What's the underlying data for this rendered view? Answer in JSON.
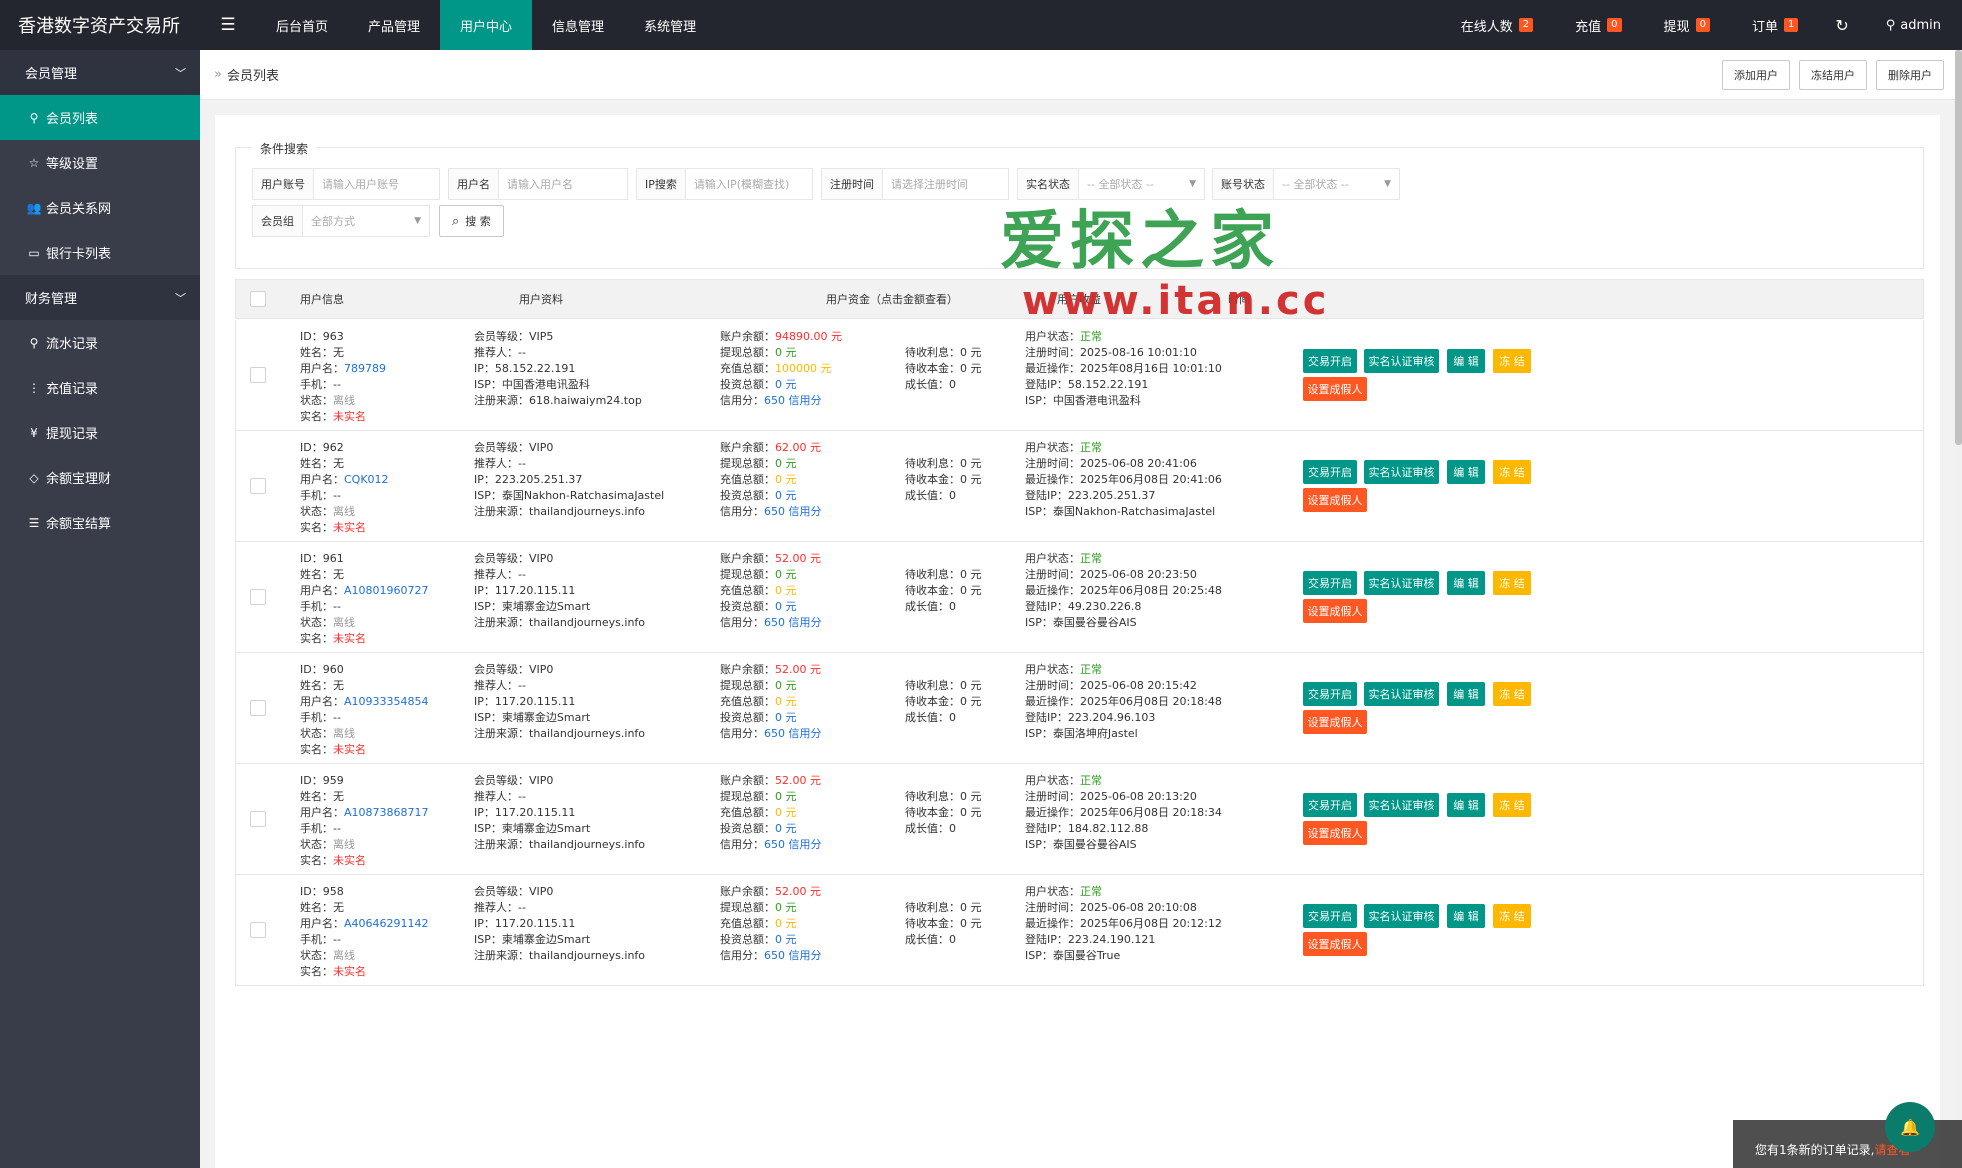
{
  "app": {
    "title": "香港数字资产交易所"
  },
  "header": {
    "menu_icon": "hamburger-icon",
    "nav": [
      {
        "label": "后台首页",
        "active": false
      },
      {
        "label": "产品管理",
        "active": false
      },
      {
        "label": "用户中心",
        "active": true
      },
      {
        "label": "信息管理",
        "active": false
      },
      {
        "label": "系统管理",
        "active": false
      }
    ],
    "online_label": "在线人数",
    "online_count": "2",
    "recharge_label": "充值",
    "recharge_count": "0",
    "withdraw_label": "提现",
    "withdraw_count": "0",
    "order_label": "订单",
    "order_count": "1",
    "user": "admin"
  },
  "sidebar": {
    "group1": "会员管理",
    "items1": [
      "会员列表",
      "等级设置",
      "会员关系网",
      "银行卡列表"
    ],
    "group2": "财务管理",
    "items2": [
      "流水记录",
      "充值记录",
      "提现记录",
      "余额宝理财",
      "余额宝结算"
    ]
  },
  "breadcrumb": {
    "label": "会员列表"
  },
  "toolbar": {
    "add": "添加用户",
    "freeze": "冻结用户",
    "delete": "删除用户"
  },
  "search": {
    "title": "条件搜索",
    "account_label": "用户账号",
    "account_ph": "请输入用户账号",
    "name_label": "用户名",
    "name_ph": "请输入用户名",
    "ip_label": "IP搜索",
    "ip_ph": "请输入IP(模糊查找)",
    "reg_label": "注册时间",
    "reg_ph": "请选择注册时间",
    "real_label": "实名状态",
    "real_val": "-- 全部状态 --",
    "acct_status_label": "账号状态",
    "acct_status_val": "-- 全部状态 --",
    "group_label": "会员组",
    "group_val": "全部方式",
    "button": "搜 索"
  },
  "table": {
    "headers": [
      "用户信息",
      "用户资料",
      "用户资金（点击金额查看）",
      "用户收益",
      "时间"
    ],
    "labels": {
      "id": "ID：",
      "name": "姓名：",
      "username": "用户名：",
      "phone": "手机：",
      "state": "状态：",
      "real": "实名：",
      "level": "会员等级：",
      "referrer": "推荐人：",
      "ip": "IP：",
      "isp": "ISP：",
      "source": "注册来源：",
      "balance": "账户余额：",
      "withdraw": "提现总额：",
      "recharge": "充值总额：",
      "invest": "投资总额：",
      "credit": "信用分：",
      "interest": "待收利息：",
      "principal": "待收本金：",
      "growth": "成长值：",
      "ustatus": "用户状态：",
      "regtime": "注册时间：",
      "lastop": "最近操作：",
      "loginip": "登陆IP：",
      "isp2": "ISP："
    },
    "buttons": {
      "trade": "交易开启",
      "verify": "实名认证审核",
      "edit": "编 辑",
      "freeze": "冻 结",
      "fake": "设置成假人"
    },
    "rows": [
      {
        "id": "963",
        "name": "无",
        "username": "789789",
        "phone": "--",
        "state": "离线",
        "real": "未实名",
        "level": "VIP5",
        "referrer": "--",
        "ip": "58.152.22.191",
        "isp": "中国香港电讯盈科",
        "source": "618.haiwaiym24.top",
        "balance": "94890.00 元",
        "withdraw": "0 元",
        "recharge": "100000 元",
        "invest": "0 元",
        "credit": "650 信用分",
        "interest": "0 元",
        "principal": "0 元",
        "growth": "0",
        "ustatus": "正常",
        "regtime": "2025-08-16 10:01:10",
        "lastop": "2025年08月16日 10:01:10",
        "loginip": "58.152.22.191",
        "isp2": "中国香港电讯盈科"
      },
      {
        "id": "962",
        "name": "无",
        "username": "CQK012",
        "phone": "--",
        "state": "离线",
        "real": "未实名",
        "level": "VIP0",
        "referrer": "--",
        "ip": "223.205.251.37",
        "isp": "泰国Nakhon-RatchasimaJastel",
        "source": "thailandjourneys.info",
        "balance": "62.00 元",
        "withdraw": "0 元",
        "recharge": "0 元",
        "invest": "0 元",
        "credit": "650 信用分",
        "interest": "0 元",
        "principal": "0 元",
        "growth": "0",
        "ustatus": "正常",
        "regtime": "2025-06-08 20:41:06",
        "lastop": "2025年06月08日 20:41:06",
        "loginip": "223.205.251.37",
        "isp2": "泰国Nakhon-RatchasimaJastel"
      },
      {
        "id": "961",
        "name": "无",
        "username": "A10801960727",
        "phone": "--",
        "state": "离线",
        "real": "未实名",
        "level": "VIP0",
        "referrer": "--",
        "ip": "117.20.115.11",
        "isp": "柬埔寨金边Smart",
        "source": "thailandjourneys.info",
        "balance": "52.00 元",
        "withdraw": "0 元",
        "recharge": "0 元",
        "invest": "0 元",
        "credit": "650 信用分",
        "interest": "0 元",
        "principal": "0 元",
        "growth": "0",
        "ustatus": "正常",
        "regtime": "2025-06-08 20:23:50",
        "lastop": "2025年06月08日 20:25:48",
        "loginip": "49.230.226.8",
        "isp2": "泰国曼谷曼谷AIS"
      },
      {
        "id": "960",
        "name": "无",
        "username": "A10933354854",
        "phone": "--",
        "state": "离线",
        "real": "未实名",
        "level": "VIP0",
        "referrer": "--",
        "ip": "117.20.115.11",
        "isp": "柬埔寨金边Smart",
        "source": "thailandjourneys.info",
        "balance": "52.00 元",
        "withdraw": "0 元",
        "recharge": "0 元",
        "invest": "0 元",
        "credit": "650 信用分",
        "interest": "0 元",
        "principal": "0 元",
        "growth": "0",
        "ustatus": "正常",
        "regtime": "2025-06-08 20:15:42",
        "lastop": "2025年06月08日 20:18:48",
        "loginip": "223.204.96.103",
        "isp2": "泰国洛坤府Jastel"
      },
      {
        "id": "959",
        "name": "无",
        "username": "A10873868717",
        "phone": "--",
        "state": "离线",
        "real": "未实名",
        "level": "VIP0",
        "referrer": "--",
        "ip": "117.20.115.11",
        "isp": "柬埔寨金边Smart",
        "source": "thailandjourneys.info",
        "balance": "52.00 元",
        "withdraw": "0 元",
        "recharge": "0 元",
        "invest": "0 元",
        "credit": "650 信用分",
        "interest": "0 元",
        "principal": "0 元",
        "growth": "0",
        "ustatus": "正常",
        "regtime": "2025-06-08 20:13:20",
        "lastop": "2025年06月08日 20:18:34",
        "loginip": "184.82.112.88",
        "isp2": "泰国曼谷曼谷AIS"
      },
      {
        "id": "958",
        "name": "无",
        "username": "A40646291142",
        "phone": "--",
        "state": "离线",
        "real": "未实名",
        "level": "VIP0",
        "referrer": "--",
        "ip": "117.20.115.11",
        "isp": "柬埔寨金边Smart",
        "source": "thailandjourneys.info",
        "balance": "52.00 元",
        "withdraw": "0 元",
        "recharge": "0 元",
        "invest": "0 元",
        "credit": "650 信用分",
        "interest": "0 元",
        "principal": "0 元",
        "growth": "0",
        "ustatus": "正常",
        "regtime": "2025-06-08 20:10:08",
        "lastop": "2025年06月08日 20:12:12",
        "loginip": "223.24.190.121",
        "isp2": "泰国曼谷True"
      }
    ]
  },
  "watermark": {
    "cn": "爱探之家",
    "url": "www.itan.cc"
  },
  "toast": {
    "text": "您有1条新的订单记录,",
    "link": "请查看"
  },
  "colors": {
    "header": "#23262e",
    "sidebar": "#393d49",
    "accent": "#009688",
    "warn": "#ffb800",
    "danger": "#ff5722"
  }
}
